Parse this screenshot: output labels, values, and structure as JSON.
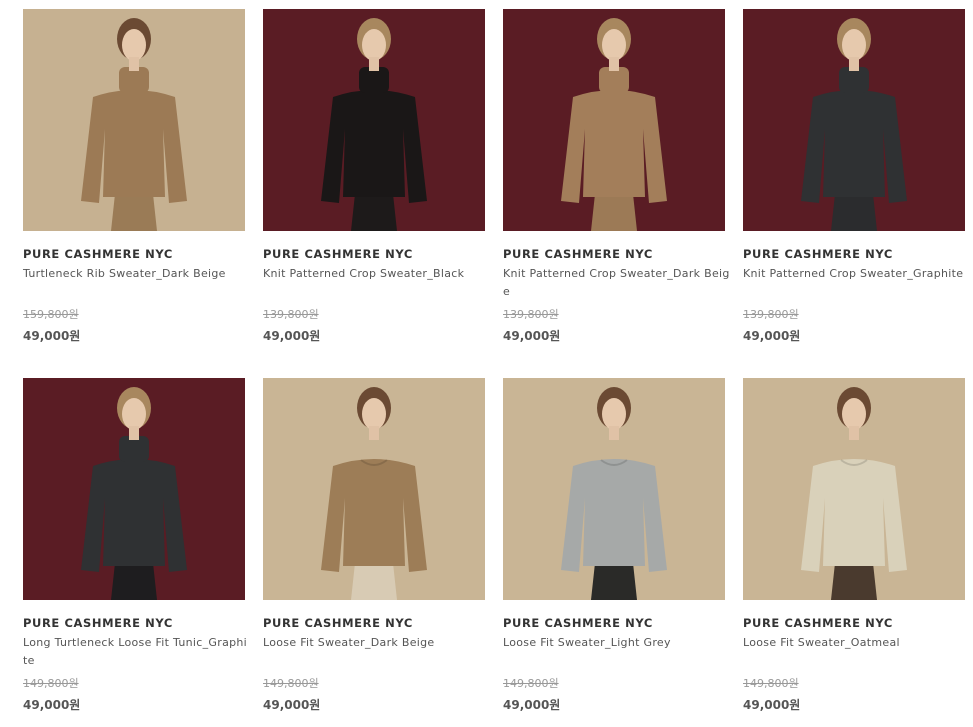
{
  "products": [
    {
      "brand": "PURE CASHMERE NYC",
      "name": "Turtleneck Rib Sweater_Dark Beige",
      "original_price": "159,800원",
      "sale_price": "49,000원",
      "background_color": "#c6b191",
      "sweater_color": "#9c7a55",
      "bottom_color": "#9a7b56",
      "turtleneck": true,
      "hair_color": "#6b4a33"
    },
    {
      "brand": "PURE CASHMERE NYC",
      "name": "Knit Patterned Crop Sweater_Black",
      "original_price": "139,800원",
      "sale_price": "49,000원",
      "background_color": "#5a1c24",
      "sweater_color": "#1a1717",
      "bottom_color": "#1d1a1a",
      "turtleneck": true,
      "hair_color": "#a8875e"
    },
    {
      "brand": "PURE CASHMERE NYC",
      "name": "Knit Patterned Crop Sweater_Dark Beige",
      "original_price": "139,800원",
      "sale_price": "49,000원",
      "background_color": "#5a1c24",
      "sweater_color": "#a37e5a",
      "bottom_color": "#9c7a56",
      "turtleneck": true,
      "hair_color": "#a8875e"
    },
    {
      "brand": "PURE CASHMERE NYC",
      "name": "Knit Patterned Crop Sweater_Graphite",
      "original_price": "139,800원",
      "sale_price": "49,000원",
      "background_color": "#5a1c24",
      "sweater_color": "#2f3133",
      "bottom_color": "#2b2c2e",
      "turtleneck": true,
      "hair_color": "#a8875e"
    },
    {
      "brand": "PURE CASHMERE NYC",
      "name": "Long Turtleneck Loose Fit Tunic_Graphite",
      "original_price": "149,800원",
      "sale_price": "49,000원",
      "background_color": "#5a1c24",
      "sweater_color": "#2f3133",
      "bottom_color": "#1e1d1f",
      "turtleneck": true,
      "hair_color": "#a8875e"
    },
    {
      "brand": "PURE CASHMERE NYC",
      "name": "Loose Fit Sweater_Dark Beige",
      "original_price": "149,800원",
      "sale_price": "49,000원",
      "background_color": "#c9b595",
      "sweater_color": "#9d7d57",
      "bottom_color": "#d8cbb4",
      "turtleneck": false,
      "hair_color": "#6b4a33"
    },
    {
      "brand": "PURE CASHMERE NYC",
      "name": "Loose Fit Sweater_Light Grey",
      "original_price": "149,800원",
      "sale_price": "49,000원",
      "background_color": "#c9b595",
      "sweater_color": "#a6a9a8",
      "bottom_color": "#2a2a28",
      "turtleneck": false,
      "hair_color": "#6b4a33"
    },
    {
      "brand": "PURE CASHMERE NYC",
      "name": "Loose Fit Sweater_Oatmeal",
      "original_price": "149,800원",
      "sale_price": "49,000원",
      "background_color": "#c9b595",
      "sweater_color": "#d9d1ba",
      "bottom_color": "#4a3a2e",
      "turtleneck": false,
      "hair_color": "#6b4a33"
    }
  ]
}
